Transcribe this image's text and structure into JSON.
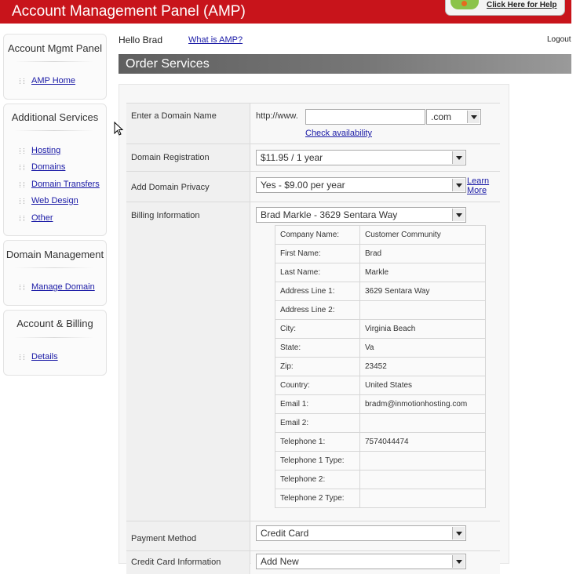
{
  "header": {
    "title": "Account Management Panel (AMP)",
    "help_label": "Click Here for Help"
  },
  "sidebar": {
    "boxes": [
      {
        "title": "Account Mgmt Panel",
        "links": [
          "AMP Home"
        ]
      },
      {
        "title": "Additional Services",
        "links": [
          "Hosting",
          "Domains",
          "Domain Transfers",
          "Web Design",
          "Other"
        ]
      },
      {
        "title": "Domain Management",
        "links": [
          "Manage Domain"
        ]
      },
      {
        "title": "Account & Billing",
        "links": [
          "Details"
        ]
      }
    ]
  },
  "topnav": {
    "greeting": "Hello Brad",
    "what_is_amp": "What is AMP?",
    "logout": "Logout"
  },
  "section": {
    "title": "Order Services"
  },
  "form": {
    "domain": {
      "label": "Enter a Domain Name",
      "prefix": "http://www.",
      "value": "",
      "tld": ".com",
      "check_link": "Check availability"
    },
    "registration": {
      "label": "Domain Registration",
      "value": "$11.95 / 1 year"
    },
    "privacy": {
      "label": "Add Domain Privacy",
      "value": "Yes - $9.00 per year",
      "learn": "Learn",
      "more": "More"
    },
    "billing": {
      "label": "Billing Information",
      "value": "Brad Markle - 3629 Sentara Way",
      "rows": [
        {
          "k": "Company Name:",
          "v": "Customer Community"
        },
        {
          "k": "First Name:",
          "v": "Brad"
        },
        {
          "k": "Last Name:",
          "v": "Markle"
        },
        {
          "k": "Address Line 1:",
          "v": "3629 Sentara Way"
        },
        {
          "k": "Address Line 2:",
          "v": ""
        },
        {
          "k": "City:",
          "v": "Virginia Beach"
        },
        {
          "k": "State:",
          "v": "Va"
        },
        {
          "k": "Zip:",
          "v": "23452"
        },
        {
          "k": "Country:",
          "v": "United States"
        },
        {
          "k": "Email 1:",
          "v": "bradm@inmotionhosting.com"
        },
        {
          "k": "Email 2:",
          "v": ""
        },
        {
          "k": "Telephone 1:",
          "v": "7574044474"
        },
        {
          "k": "Telephone 1 Type:",
          "v": ""
        },
        {
          "k": "Telephone 2:",
          "v": ""
        },
        {
          "k": "Telephone 2 Type:",
          "v": ""
        }
      ]
    },
    "payment": {
      "label": "Payment Method",
      "value": "Credit Card"
    },
    "credit_card": {
      "label": "Credit Card Information",
      "value": "Add New"
    }
  },
  "colors": {
    "header_red": "#c8141b",
    "link_blue": "#1a1aa6"
  }
}
